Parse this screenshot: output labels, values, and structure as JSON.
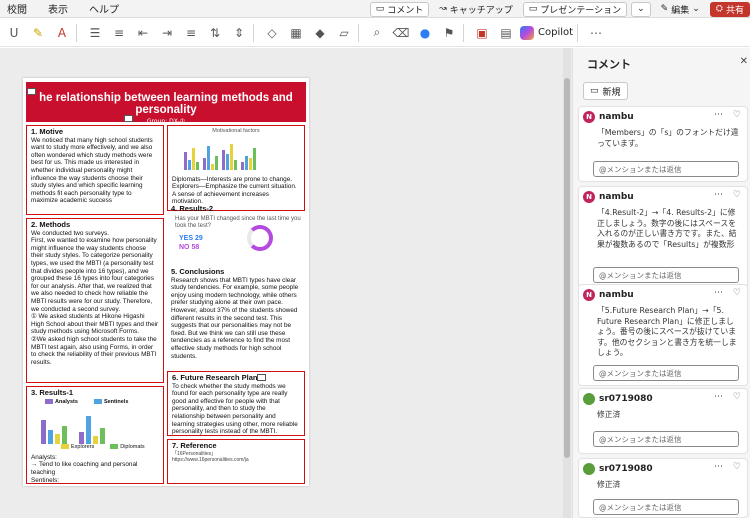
{
  "menubar": {
    "items": [
      "校閲",
      "表示",
      "ヘルプ"
    ],
    "comment_btn": "コメント",
    "catchup_btn": "キャッチアップ",
    "present_btn": "プレゼンテーション",
    "edit_btn": "編集",
    "share_btn": "共有"
  },
  "ribbon": {
    "copilot": "Copilot"
  },
  "poster": {
    "title": "he relationship between learning methods and personality",
    "group": "Group: DX-①",
    "members": "Members: Ikuda Kitagawa, Hiromu Kitagawa, Yuya Tokuda, Rin Toda",
    "motive": {
      "title": "1. Motive",
      "text": "We noticed that many high school students want to study more effectively, and we also often wondered which study methods were best for us. This made us interested in whether individual personality might influence the way students choose their study styles and which specific learning methods fit each personality type to maximize academic success"
    },
    "methods": {
      "title": "2. Methods",
      "text": "We conducted two surveys.\nFirst, we wanted to examine how personality might influence the way students choose their study styles. To categorize personality types, we used the MBTI (a personality test that divides people into 16 types), and we grouped these 16 types into four categories for our analysis. After that, we realized that we also needed to check how reliable the MBTI results were for our study. Therefore, we conducted a second survey.\n① We asked students at Hikone Higashi High School about their MBTI types and their study methods using Microsoft Forms.\n②We asked high school students to take the MBTI test again, also using Forms, in order to check the reliability of their previous MBTI results."
    },
    "results1": {
      "title": "3. Results-1",
      "legend": [
        "Analysts",
        "Sentinels",
        "Explorers",
        "Diplomats"
      ],
      "text": "Analysts:\n→ Tend to like coaching and personal teaching\nSentinels:\n→ Tend to prefer studying on their own"
    },
    "motivational": {
      "caption": "Motivational factors",
      "text": "Diplomats—Interests are prone to change.\nExplorers—Emphasize the current situation.\nA sense of achievement increases motivation."
    },
    "results2": {
      "title": "4. Results-2",
      "question": "Has your MBTI changed since the last time you took the test?",
      "yes": "YES 29",
      "no": "NO 58"
    },
    "conclusions": {
      "title": "5. Conclusions",
      "text": "Research shows that MBTI types have clear study tendencies. For example, some people enjoy using modern technology, while others prefer studying alone at their own pace. However, about 37% of the students showed different results in the second test. This suggests that our personalities may not be fixed. But we think we can still use these tendencies as a reference to find the most effective study methods for high school students."
    },
    "future": {
      "title": "6. Future Research Plan",
      "text": "To check whether the study methods we found for each personality type are really good and effective for people with that personality, and then to study the relationship between personality and learning strategies using other, more reliable personality tests instead of the MBTI."
    },
    "reference": {
      "title": "7. Reference",
      "text": "「16Personalities」\nhttps://www.16personalities.com/ja"
    }
  },
  "pane": {
    "title": "コメント",
    "new_btn": "新規",
    "reply_placeholder": "@メンションまたは返信",
    "comments": [
      {
        "author": "nambu",
        "initial": "N",
        "text": "「Members」の「s」のフォントだけ違っています。"
      },
      {
        "author": "nambu",
        "initial": "N",
        "text": "「4.Result-2」→「4. Results-2」に修正しましょう。数字の後にはスペースを入れるのが正しい書き方です。また、結果が複数あるので「Results」が複数形に"
      },
      {
        "author": "nambu",
        "initial": "N",
        "text": "「5.Future Research Plan」→「5. Future Research Plan」に修正しましょう。番号の後にスペースが抜けています。他のセクションと書き方を統一しましょう。"
      },
      {
        "author": "sr0719080",
        "initial": "",
        "text": "修正済"
      },
      {
        "author": "sr0719080",
        "initial": "",
        "text": "修正済"
      }
    ]
  }
}
